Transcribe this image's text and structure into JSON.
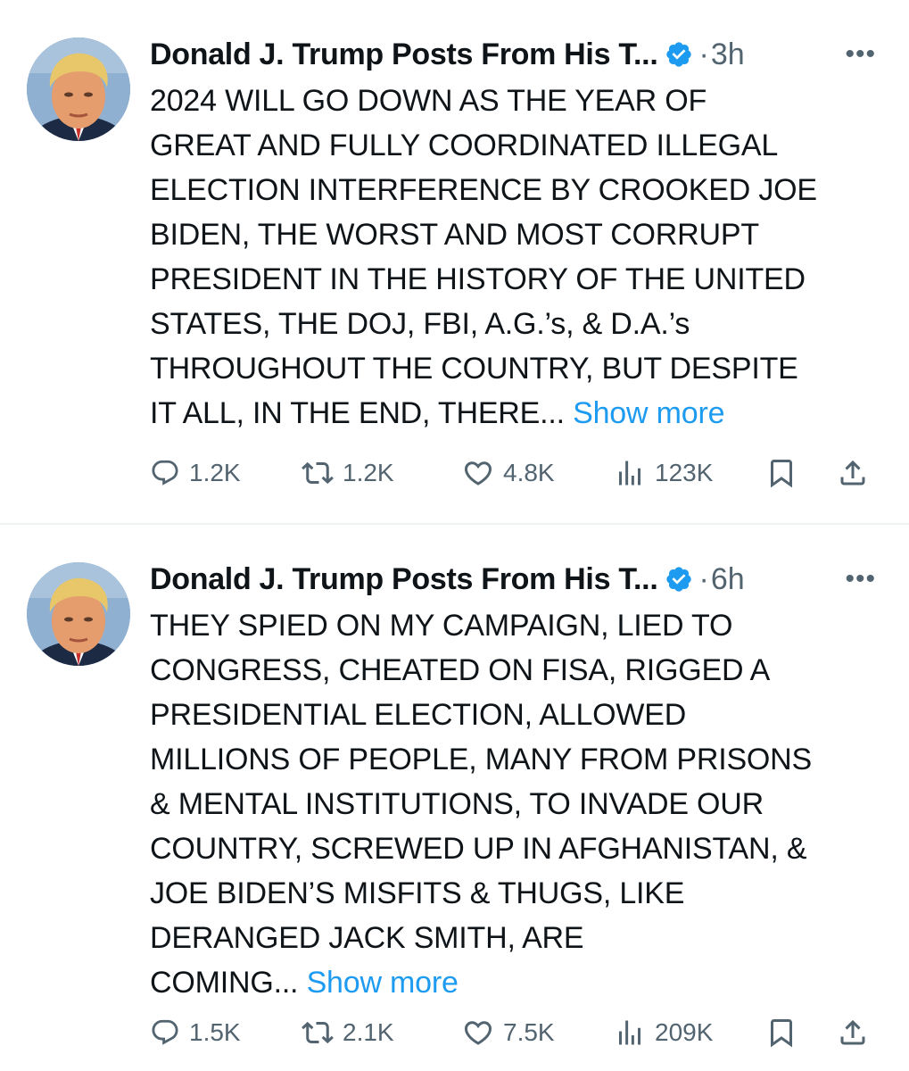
{
  "tweets": [
    {
      "author": "Donald J. Trump Posts From His T...",
      "separator": "·",
      "time": "3h",
      "more": "•••",
      "text": "2024 WILL GO DOWN AS THE YEAR OF\nGREAT AND FULLY COORDINATED ILLEGAL\nELECTION INTERFERENCE BY CROOKED JOE\nBIDEN, THE WORST AND MOST CORRUPT\nPRESIDENT IN THE HISTORY OF THE UNITED\nSTATES, THE DOJ, FBI, A.G.’s, & D.A.’s\nTHROUGHOUT THE COUNTRY, BUT DESPITE\nIT ALL, IN THE END, THERE... ",
      "show_more": "Show more",
      "replies": "1.2K",
      "reposts": "1.2K",
      "likes": "4.8K",
      "views": "123K"
    },
    {
      "author": "Donald J. Trump Posts From His T...",
      "separator": "·",
      "time": "6h",
      "more": "•••",
      "text": "THEY SPIED ON MY CAMPAIGN, LIED TO\nCONGRESS, CHEATED ON FISA, RIGGED A\nPRESIDENTIAL ELECTION, ALLOWED\nMILLIONS OF PEOPLE, MANY FROM PRISONS\n& MENTAL INSTITUTIONS, TO INVADE OUR\nCOUNTRY, SCREWED UP IN AFGHANISTAN, &\nJOE BIDEN’S MISFITS & THUGS, LIKE\nDERANGED JACK SMITH, ARE\nCOMING... ",
      "show_more": "Show more",
      "replies": "1.5K",
      "reposts": "2.1K",
      "likes": "7.5K",
      "views": "209K"
    }
  ],
  "colors": {
    "text": "#0f1419",
    "secondary": "#536471",
    "link": "#1d9bf0",
    "verified": "#1d9bf0",
    "divider": "#eff3f4"
  }
}
